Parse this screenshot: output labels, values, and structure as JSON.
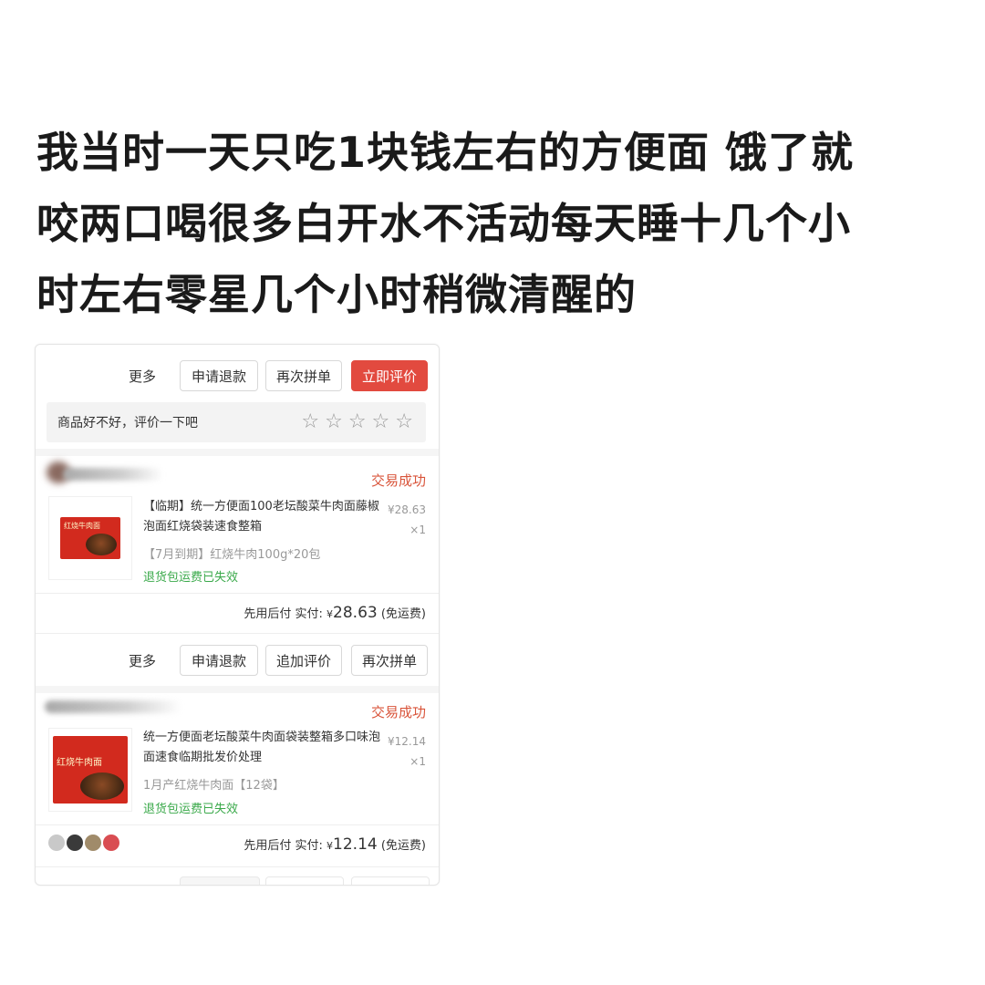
{
  "headline": {
    "lines": [
      "我当时一天只吃1块钱左右的方便面 饿了就",
      "咬两口喝很多白开水不活动每天睡十几个小",
      "时左右零星几个小时稍微清醒的"
    ]
  },
  "order_top": {
    "more_label": "更多",
    "refund_label": "申请退款",
    "reorder_label": "再次拼单",
    "review_label": "立即评价",
    "rate_prompt": "商品好不好，评价一下吧",
    "stars": "☆☆☆☆☆"
  },
  "order1": {
    "status": "交易成功",
    "pack_label": "红烧牛肉面",
    "title": "【临期】统一方便面100老坛酸菜牛肉面藤椒泡面红烧袋装速食整箱",
    "price": "¥28.63",
    "qty": "×1",
    "spec": "【7月到期】红烧牛肉100g*20包",
    "refund_note": "退货包运费已失效",
    "pay_method": "先用后付",
    "paid_label": "实付:",
    "currency": "¥",
    "paid_amount": "28.63",
    "shipping": "(免运费)",
    "more_label": "更多",
    "refund_label": "申请退款",
    "append_review_label": "追加评价",
    "reorder_label": "再次拼单"
  },
  "order2": {
    "status": "交易成功",
    "pack_label": "红烧牛肉面",
    "title": "统一方便面老坛酸菜牛肉面袋装整箱多口味泡面速食临期批发价处理",
    "price": "¥12.14",
    "qty": "×1",
    "spec": "1月产红烧牛肉面【12袋】",
    "refund_note": "退货包运费已失效",
    "pay_method": "先用后付",
    "paid_label": "实付:",
    "currency": "¥",
    "paid_amount": "12.14",
    "shipping": "(免运费)"
  },
  "colors": {
    "accent": "#e24a3f",
    "status": "#d9543a",
    "green": "#3aa94a"
  }
}
